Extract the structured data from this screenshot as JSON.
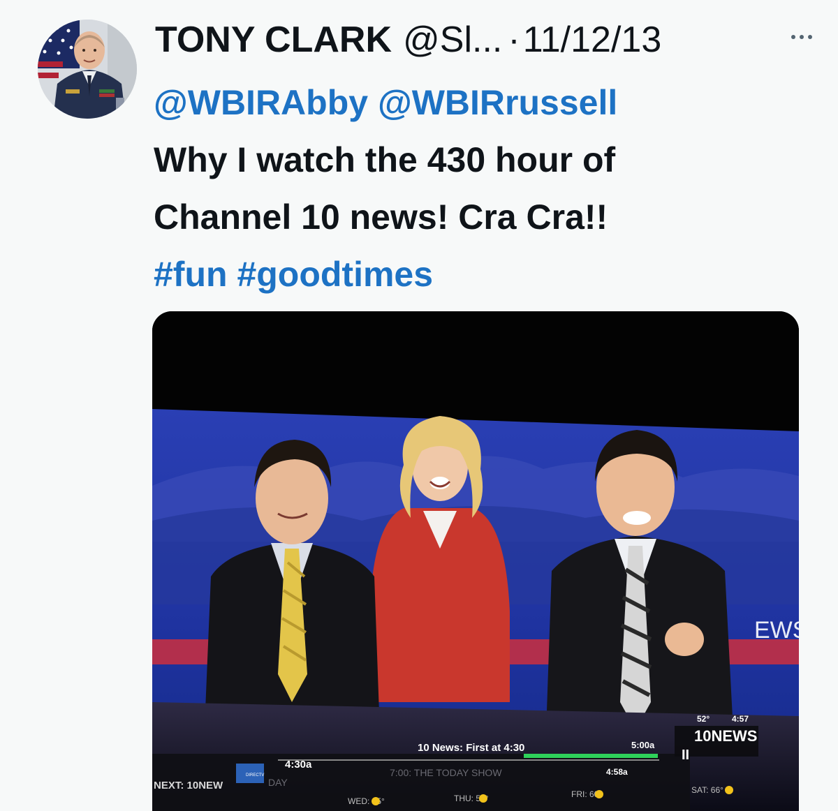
{
  "tweet": {
    "author_name": "TONY CLARK",
    "author_handle": "@Sl...",
    "separator": "·",
    "timestamp": "11/12/13",
    "mentions": [
      "@WBIRAbby",
      "@WBIRrussell"
    ],
    "text_line1": "Why I watch the 430 hour of",
    "text_line2": "Channel 10 news!  Cra Cra!!",
    "hashtags": [
      "#fun",
      "#goodtimes"
    ]
  },
  "media": {
    "ticker": {
      "time_now": "4:30a",
      "program": "10 News: First at 4:30",
      "end_time": "5:00a",
      "next_time": "4:58a",
      "next_show": "7:00: THE TODAY SHOW",
      "next_label": "NEXT: 10NEW",
      "next_suffix": "DAY",
      "directv": "DIRECTV",
      "temp": "52°",
      "clock": "4:57",
      "station": "10NEWS",
      "pause": "II",
      "forecast": [
        "WED: 45°",
        "THU: 54°",
        "FRI: 60°",
        "SAT: 66°"
      ],
      "wall_text": "EWS"
    }
  },
  "colors": {
    "link": "#1d72c4",
    "text": "#0f1419",
    "background": "#f7f9f9"
  },
  "icons": {
    "more": "more-horizontal-icon"
  }
}
